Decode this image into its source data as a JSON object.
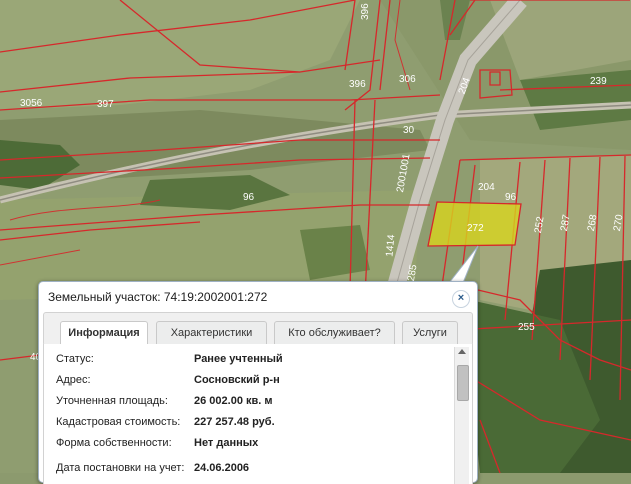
{
  "map": {
    "parcel_labels": [
      "396",
      "3056",
      "397",
      "396",
      "306",
      "239",
      "30",
      "204",
      "204",
      "272",
      "252",
      "287",
      "268",
      "270",
      "2001001",
      "1414",
      "285",
      "255",
      "96",
      "96",
      "40"
    ]
  },
  "popup": {
    "title": "Земельный участок: 74:19:2002001:272",
    "close_label": "×",
    "tabs": [
      {
        "label": "Информация",
        "active": true
      },
      {
        "label": "Характеристики",
        "active": false
      },
      {
        "label": "Кто обслуживает?",
        "active": false
      },
      {
        "label": "Услуги",
        "active": false
      }
    ],
    "fields": [
      {
        "label": "Статус:",
        "value": "Ранее учтенный"
      },
      {
        "label": "Адрес:",
        "value": "Сосновский р-н"
      },
      {
        "label": "Уточненная площадь:",
        "value": "26 002.00 кв. м"
      },
      {
        "label": "Кадастровая стоимость:",
        "value": "227 257.48 руб."
      },
      {
        "label": "Форма собственности:",
        "value": "Нет данных"
      },
      {
        "label": "Дата постановки на учет:",
        "value": "24.06.2006"
      }
    ]
  },
  "colors": {
    "boundary": "#d6282b",
    "selected_fill": "#d7d51e",
    "terrain": "#8c9a6e"
  }
}
